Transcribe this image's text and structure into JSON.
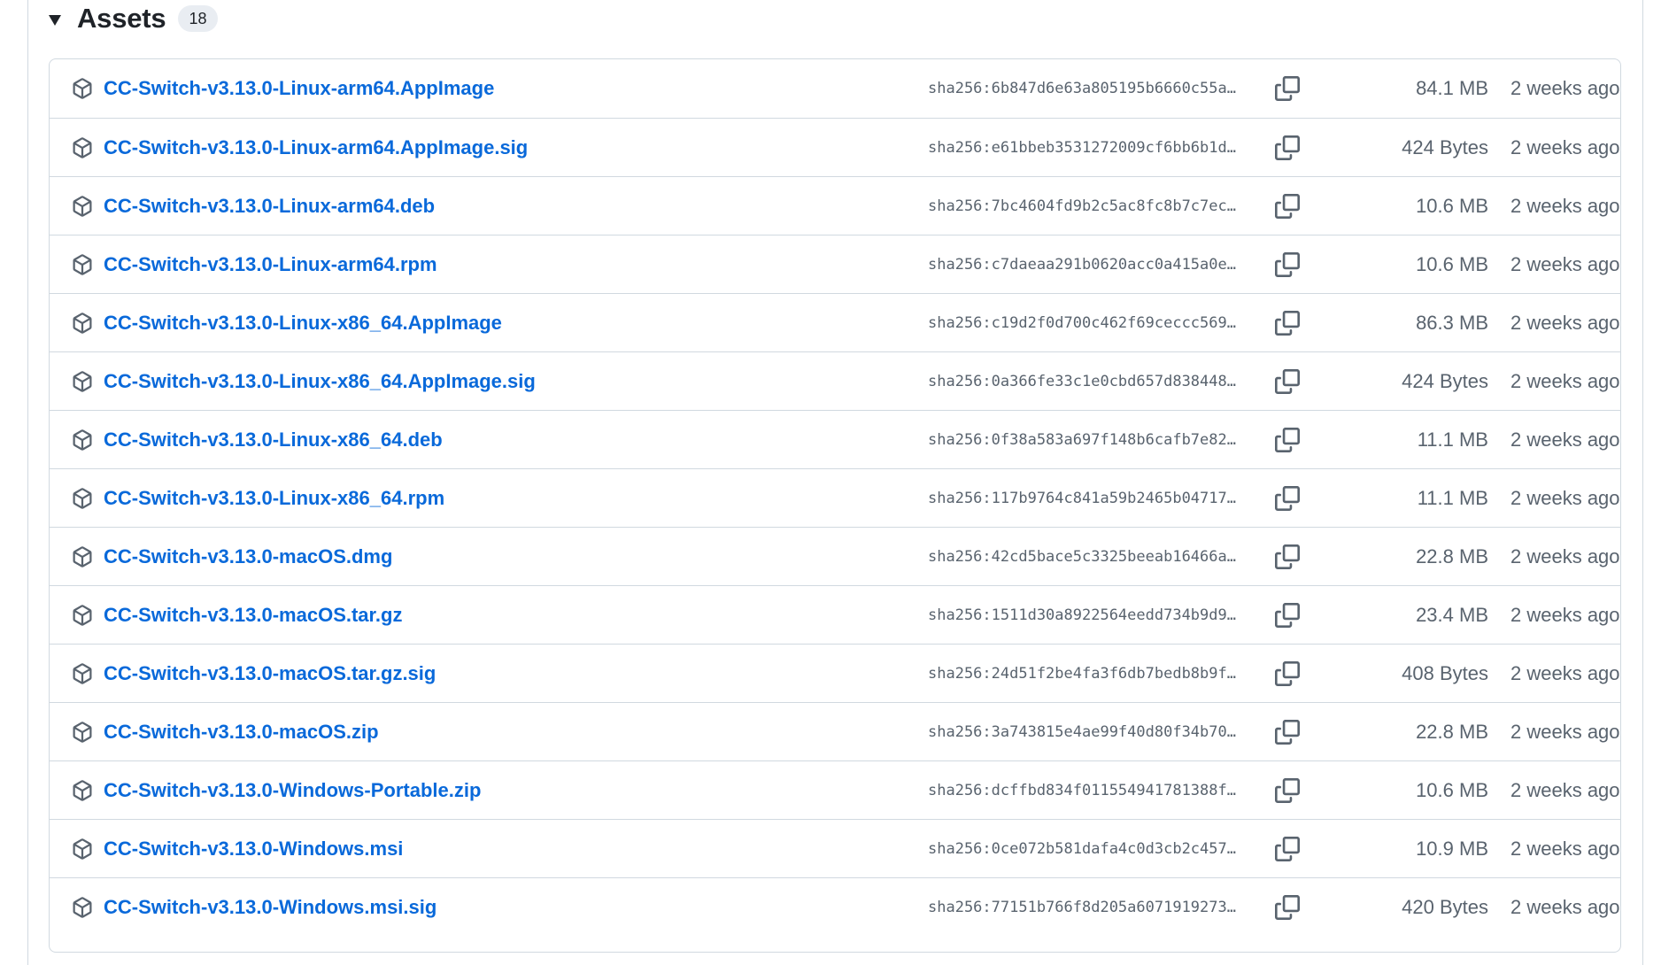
{
  "assets": {
    "title": "Assets",
    "count": "18",
    "items": [
      {
        "name": "CC-Switch-v3.13.0-Linux-arm64.AppImage",
        "sha": "sha256:6b847d6e63a805195b6660c55a…",
        "size": "84.1 MB",
        "date": "2 weeks ago"
      },
      {
        "name": "CC-Switch-v3.13.0-Linux-arm64.AppImage.sig",
        "sha": "sha256:e61bbeb3531272009cf6bb6b1d…",
        "size": "424 Bytes",
        "date": "2 weeks ago"
      },
      {
        "name": "CC-Switch-v3.13.0-Linux-arm64.deb",
        "sha": "sha256:7bc4604fd9b2c5ac8fc8b7c7ec…",
        "size": "10.6 MB",
        "date": "2 weeks ago"
      },
      {
        "name": "CC-Switch-v3.13.0-Linux-arm64.rpm",
        "sha": "sha256:c7daeaa291b0620acc0a415a0e…",
        "size": "10.6 MB",
        "date": "2 weeks ago"
      },
      {
        "name": "CC-Switch-v3.13.0-Linux-x86_64.AppImage",
        "sha": "sha256:c19d2f0d700c462f69ceccc569…",
        "size": "86.3 MB",
        "date": "2 weeks ago"
      },
      {
        "name": "CC-Switch-v3.13.0-Linux-x86_64.AppImage.sig",
        "sha": "sha256:0a366fe33c1e0cbd657d838448…",
        "size": "424 Bytes",
        "date": "2 weeks ago"
      },
      {
        "name": "CC-Switch-v3.13.0-Linux-x86_64.deb",
        "sha": "sha256:0f38a583a697f148b6cafb7e82…",
        "size": "11.1 MB",
        "date": "2 weeks ago"
      },
      {
        "name": "CC-Switch-v3.13.0-Linux-x86_64.rpm",
        "sha": "sha256:117b9764c841a59b2465b04717…",
        "size": "11.1 MB",
        "date": "2 weeks ago"
      },
      {
        "name": "CC-Switch-v3.13.0-macOS.dmg",
        "sha": "sha256:42cd5bace5c3325beeab16466a…",
        "size": "22.8 MB",
        "date": "2 weeks ago"
      },
      {
        "name": "CC-Switch-v3.13.0-macOS.tar.gz",
        "sha": "sha256:1511d30a8922564eedd734b9d9…",
        "size": "23.4 MB",
        "date": "2 weeks ago"
      },
      {
        "name": "CC-Switch-v3.13.0-macOS.tar.gz.sig",
        "sha": "sha256:24d51f2be4fa3f6db7bedb8b9f…",
        "size": "408 Bytes",
        "date": "2 weeks ago"
      },
      {
        "name": "CC-Switch-v3.13.0-macOS.zip",
        "sha": "sha256:3a743815e4ae99f40d80f34b70…",
        "size": "22.8 MB",
        "date": "2 weeks ago"
      },
      {
        "name": "CC-Switch-v3.13.0-Windows-Portable.zip",
        "sha": "sha256:dcffbd834f011554941781388f…",
        "size": "10.6 MB",
        "date": "2 weeks ago"
      },
      {
        "name": "CC-Switch-v3.13.0-Windows.msi",
        "sha": "sha256:0ce072b581dafa4c0d3cb2c457…",
        "size": "10.9 MB",
        "date": "2 weeks ago"
      },
      {
        "name": "CC-Switch-v3.13.0-Windows.msi.sig",
        "sha": "sha256:77151b766f8d205a6071919273…",
        "size": "420 Bytes",
        "date": "2 weeks ago"
      }
    ]
  },
  "icons": {
    "asset": "package-icon",
    "copy": "copy-icon",
    "toggle": "triangle-down-icon"
  },
  "colors": {
    "link": "#0969da",
    "muted": "#59636e",
    "border": "#d1d9e0",
    "counter_bg": "#e9edf2",
    "text": "#1f2328"
  }
}
